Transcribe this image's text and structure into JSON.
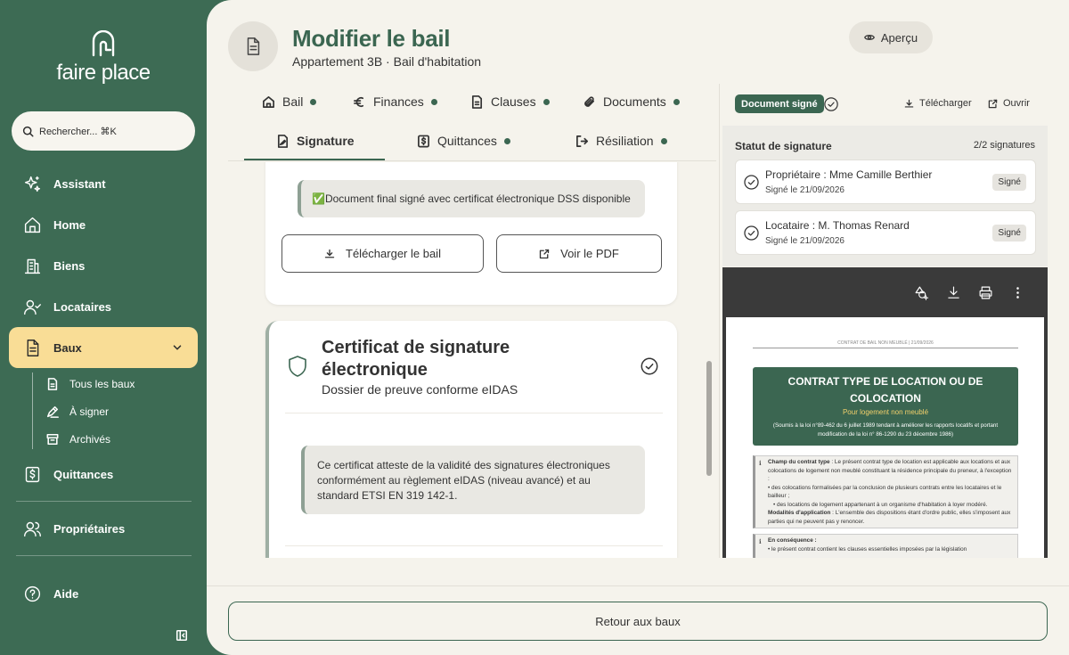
{
  "brand": {
    "name": "faire place"
  },
  "search": {
    "placeholder": "Rechercher... ⌘K"
  },
  "nav": {
    "assistant": "Assistant",
    "home": "Home",
    "biens": "Biens",
    "locataires": "Locataires",
    "baux": "Baux",
    "baux_sub": [
      "Tous les baux",
      "À signer",
      "Archivés"
    ],
    "quittances": "Quittances",
    "proprietaires": "Propriétaires",
    "aide": "Aide"
  },
  "header": {
    "title": "Modifier le bail",
    "subtitle": "Appartement 3B · Bail d'habitation",
    "preview_label": "Aperçu"
  },
  "tabs": {
    "row1": [
      "Bail",
      "Finances",
      "Clauses",
      "Documents"
    ],
    "row2": [
      "Signature",
      "Quittances",
      "Résiliation"
    ],
    "active": "Signature"
  },
  "signature_card": {
    "notice": "✅Document final signé avec certificat électronique DSS disponible",
    "download_label": "Télécharger le bail",
    "view_pdf_label": "Voir le PDF"
  },
  "certificate": {
    "title": "Certificat de signature électronique",
    "subtitle": "Dossier de preuve conforme eIDAS",
    "text": "Ce certificat atteste de la validité des signatures électroniques conformément au règlement eIDAS (niveau avancé) et au standard ETSI EN 319 142-1."
  },
  "right_panel": {
    "badge": "Document signé",
    "download": "Télécharger",
    "open": "Ouvrir",
    "status_title": "Statut de signature",
    "status_count": "2/2 signatures",
    "signers": [
      {
        "name": "Propriétaire : Mme Camille Berthier",
        "date": "Signé le 21/09/2026",
        "badge": "Signé"
      },
      {
        "name": "Locataire : M. Thomas Renard",
        "date": "Signé le 21/09/2026",
        "badge": "Signé"
      }
    ]
  },
  "pdf": {
    "header": "CONTRAT DE BAIL NON MEUBLÉ | 21/09/2026",
    "title": "CONTRAT TYPE DE LOCATION OU DE COLOCATION",
    "subtitle": "Pour logement non meublé",
    "legal": "(Soumis à la loi n°89-462 du 6 juillet 1989 tendant à améliorer les rapports locatifs et portant modification de la loi n° 86-1290 du 23 décembre 1986)",
    "sec1_label": "Champ du contrat type",
    "sec1_text": " : Le présent contrat type de location est applicable aux locations et aux colocations de logement non meublé constituant la résidence principale du preneur, à l'exception :",
    "sec1_b1": "• des colocations formalisées par la conclusion de plusieurs contrats entre les locataires et le bailleur ;",
    "sec1_b2": "• des locations de logement appartenant à un organisme d'habitation à loyer modéré.",
    "sec1_label2": "Modalités d'application",
    "sec1_text2": " : L'ensemble des dispositions étant d'ordre public, elles s'imposent aux parties qui ne peuvent pas y renoncer.",
    "sec2_label": "En conséquence :",
    "sec2_b1": "• le présent contrat contient les clauses essentielles imposées par la législation"
  },
  "footer": {
    "return_label": "Retour aux baux"
  }
}
